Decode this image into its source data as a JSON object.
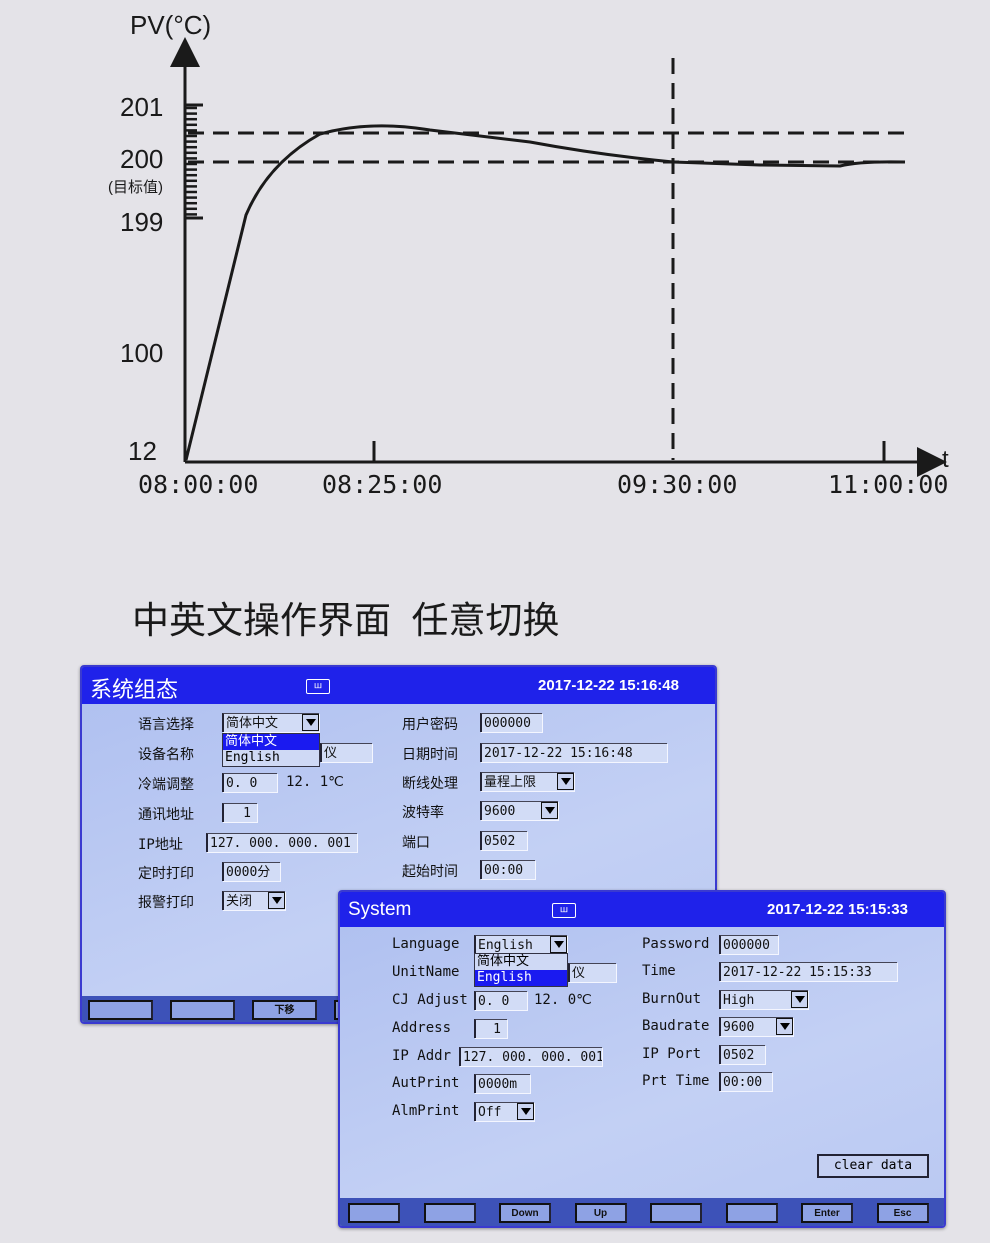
{
  "chart": {
    "y_title": "PV(°C)",
    "x_title": "t",
    "y_ticks": [
      "201",
      "200",
      "199",
      "100",
      "12"
    ],
    "target_note": "(目标值)",
    "x_ticks": [
      "08:00:00",
      "08:25:00",
      "09:30:00",
      "11:00:00"
    ]
  },
  "headline": "中英文操作界面  任意切换",
  "screen_cn": {
    "title": "系统组态",
    "icon": "wave-icon",
    "datetime": "2017-12-22 15:16:48",
    "left": [
      {
        "label": "语言选择",
        "value": "简体中文"
      },
      {
        "label": "设备名称",
        "value": "仪"
      },
      {
        "label": "冷端调整",
        "value": "0. 0",
        "extra": "12. 1℃"
      },
      {
        "label": "通讯地址",
        "value": "1"
      },
      {
        "label": "IP地址",
        "value": "127. 000. 000. 001"
      },
      {
        "label": "定时打印",
        "value": "0000分"
      },
      {
        "label": "报警打印",
        "value": "关闭"
      }
    ],
    "lang_options": [
      "简体中文",
      "English"
    ],
    "right": [
      {
        "label": "用户密码",
        "value": "000000"
      },
      {
        "label": "日期时间",
        "value": "2017-12-22  15:16:48"
      },
      {
        "label": "断线处理",
        "value": "量程上限"
      },
      {
        "label": "波特率",
        "value": "9600"
      },
      {
        "label": "端口",
        "value": "0502"
      },
      {
        "label": "起始时间",
        "value": "00:00"
      }
    ],
    "buttons": [
      "",
      "",
      "下移",
      ""
    ]
  },
  "screen_en": {
    "title": "System",
    "icon": "wave-icon",
    "datetime": "2017-12-22 15:15:33",
    "left": [
      {
        "label": "Language",
        "value": "English"
      },
      {
        "label": "UnitName",
        "value": "仪"
      },
      {
        "label": "CJ Adjust",
        "value": "0. 0",
        "extra": "12. 0℃"
      },
      {
        "label": "Address",
        "value": "1"
      },
      {
        "label": "IP Addr",
        "value": "127. 000. 000. 001"
      },
      {
        "label": "AutPrint",
        "value": "0000m"
      },
      {
        "label": "AlmPrint",
        "value": "Off"
      }
    ],
    "lang_options": [
      "简体中文",
      "English"
    ],
    "right": [
      {
        "label": "Password",
        "value": "000000"
      },
      {
        "label": "Time",
        "value": "2017-12-22  15:15:33"
      },
      {
        "label": "BurnOut",
        "value": "High"
      },
      {
        "label": "Baudrate",
        "value": "9600"
      },
      {
        "label": "IP Port",
        "value": "0502"
      },
      {
        "label": "Prt Time",
        "value": "00:00"
      }
    ],
    "clear_label": "clear data",
    "buttons": [
      "",
      "",
      "Down",
      "Up",
      "",
      "",
      "Enter",
      "Esc"
    ]
  },
  "colors": {
    "title_bar": "#1f22ea",
    "screen_bg": "#b9c8f2",
    "selected": "#1a1af0"
  }
}
